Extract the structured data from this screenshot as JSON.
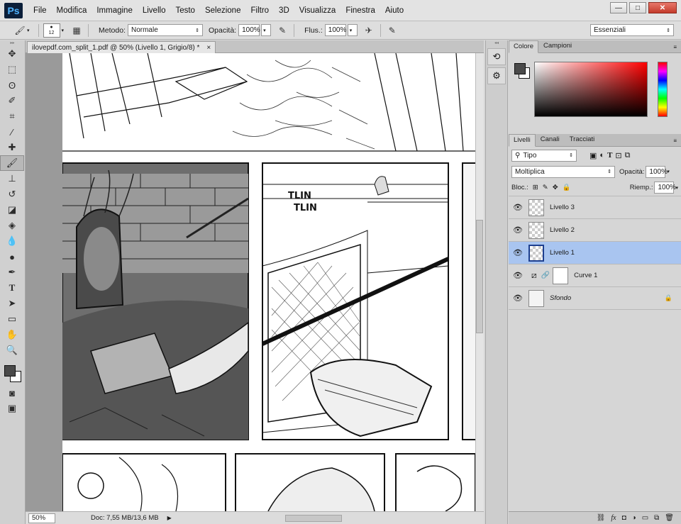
{
  "app": {
    "logo": "Ps",
    "brand_color": "#0b1f3a",
    "logo_text_color": "#4fb3ff"
  },
  "menu": [
    "File",
    "Modifica",
    "Immagine",
    "Livello",
    "Testo",
    "Selezione",
    "Filtro",
    "3D",
    "Visualizza",
    "Finestra",
    "Aiuto"
  ],
  "window_buttons": {
    "minimize": "—",
    "maximize": "□",
    "close": "✕"
  },
  "options": {
    "brush_size": "12",
    "mode_label": "Metodo:",
    "mode_value": "Normale",
    "opacity_label": "Opacità:",
    "opacity_value": "100%",
    "flow_label": "Flus.:",
    "flow_value": "100%",
    "workspace": "Essenziali"
  },
  "document": {
    "tab_title": "ilovepdf.com_split_1.pdf @ 50% (Livello 1, Grigio/8) *",
    "zoom": "50%",
    "doc_info": "Doc: 7,55 MB/13,6 MB",
    "comic_sfx_1": "TLIN",
    "comic_sfx_2": "TLIN"
  },
  "color_panel": {
    "tabs": [
      "Colore",
      "Campioni"
    ],
    "foreground": "#4a4a4a",
    "background": "#ffffff"
  },
  "layers_panel": {
    "tabs": [
      "Livelli",
      "Canali",
      "Tracciati"
    ],
    "filter_value": "Tipo",
    "blend_mode": "Moltiplica",
    "opacity_label": "Opacità:",
    "opacity_value": "100%",
    "lock_label": "Bloc.:",
    "fill_label": "Riemp.:",
    "fill_value": "100%",
    "layers": [
      {
        "name": "Livello 3",
        "selected": false
      },
      {
        "name": "Livello 2",
        "selected": false
      },
      {
        "name": "Livello 1",
        "selected": true
      },
      {
        "name": "Curve 1",
        "selected": false
      },
      {
        "name": "Sfondo",
        "selected": false
      }
    ],
    "selected_color": "#a9c5f0"
  },
  "icons": [
    "move-tool-icon",
    "marquee-icon",
    "lasso-icon",
    "quick-select-icon",
    "crop-icon",
    "eyedropper-icon",
    "healing-icon",
    "brush-icon",
    "stamp-icon",
    "history-brush-icon",
    "eraser-icon",
    "bucket-icon",
    "blur-icon",
    "dodge-icon",
    "pen-icon",
    "type-icon",
    "path-select-icon",
    "rectangle-icon",
    "hand-icon",
    "zoom-icon",
    "eye-icon",
    "lock-icon",
    "link-icon",
    "fx-icon",
    "trash-icon"
  ]
}
